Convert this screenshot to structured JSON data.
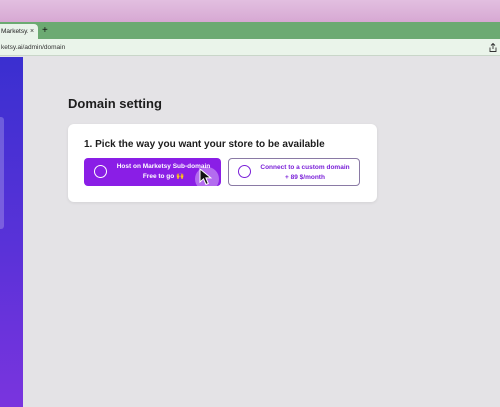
{
  "browser": {
    "tab_title": "Marketsy.ai",
    "tab_close": "×",
    "new_tab": "+",
    "url": "ketsy.ai/admin/domain",
    "share_icon": "share-icon"
  },
  "colors": {
    "accent": "#8a1ee6",
    "sidebar_top": "#3a2fd0",
    "sidebar_bottom": "#7a34de",
    "tabbar": "#6caa72"
  },
  "main": {
    "title": "Domain setting",
    "card": {
      "heading": "1. Pick the way you want your store to be available",
      "options": [
        {
          "line1": "Host on Marketsy Sub-domain",
          "line2": "Free to go 🙌",
          "selected": true
        },
        {
          "line1": "Connect to a custom domain",
          "line2": "+ 89 $/month",
          "selected": false
        }
      ]
    }
  }
}
